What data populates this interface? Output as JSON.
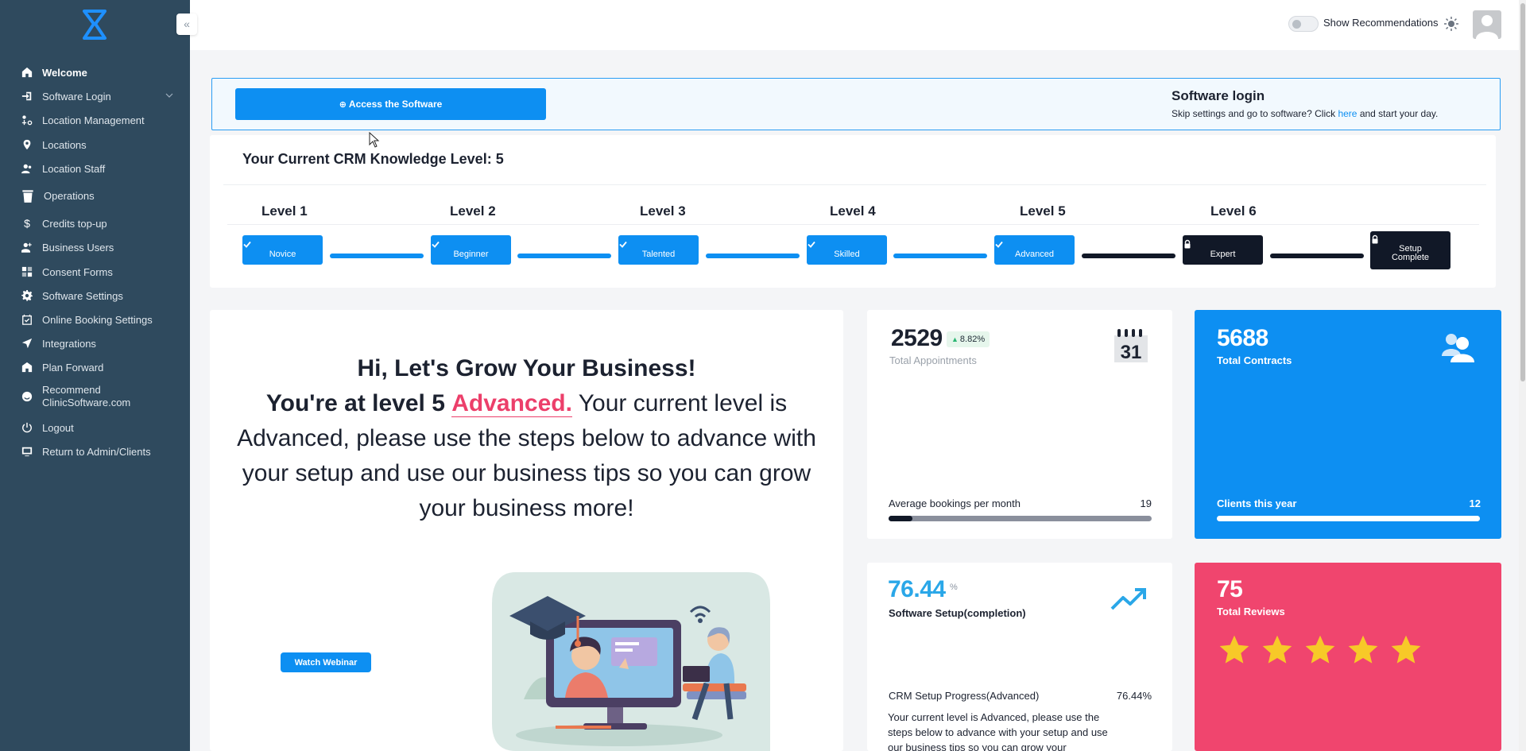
{
  "sidebar": {
    "items": [
      {
        "label": "Welcome",
        "icon": "home-icon",
        "active": true
      },
      {
        "label": "Software Login",
        "icon": "login-icon",
        "has_submenu": true
      },
      {
        "label": "Location Management",
        "icon": "location-management-icon"
      },
      {
        "label": "Locations",
        "icon": "map-pin-icon"
      },
      {
        "label": "Location Staff",
        "icon": "staff-icon"
      },
      {
        "label": "Operations",
        "icon": "trash-icon"
      },
      {
        "label": "Credits top-up",
        "icon": "dollar-icon"
      },
      {
        "label": "Business Users",
        "icon": "add-user-icon"
      },
      {
        "label": "Consent Forms",
        "icon": "grid-icon"
      },
      {
        "label": "Software Settings",
        "icon": "gear-icon"
      },
      {
        "label": "Online Booking Settings",
        "icon": "calendar-icon"
      },
      {
        "label": "Integrations",
        "icon": "send-icon"
      },
      {
        "label": "Plan Forward",
        "icon": "building-icon"
      },
      {
        "label": "Recommend ClinicSoftware.com",
        "icon": "smile-icon"
      },
      {
        "label": "Logout",
        "icon": "power-icon"
      },
      {
        "label": "Return to Admin/Clients",
        "icon": "monitor-icon"
      }
    ]
  },
  "topbar": {
    "toggle_label": "Show Recommendations",
    "toggle_on": false
  },
  "banner": {
    "button_label": "Access the Software",
    "title": "Software login",
    "subtitle_before": "Skip settings and go to software? Click",
    "subtitle_link": "here",
    "subtitle_after": "and start your day."
  },
  "knowledge": {
    "title": "Your Current CRM Knowledge Level: 5",
    "levels": [
      {
        "heading": "Level 1",
        "badge": "Novice",
        "state": "complete"
      },
      {
        "heading": "Level 2",
        "badge": "Beginner",
        "state": "complete"
      },
      {
        "heading": "Level 3",
        "badge": "Talented",
        "state": "complete"
      },
      {
        "heading": "Level 4",
        "badge": "Skilled",
        "state": "complete"
      },
      {
        "heading": "Level 5",
        "badge": "Advanced",
        "state": "complete"
      },
      {
        "heading": "Level 6",
        "badge": "Expert",
        "state": "locked"
      },
      {
        "heading": "",
        "badge": "Setup Complete",
        "state": "locked"
      }
    ]
  },
  "grow": {
    "line1": "Hi, Let's Grow Your Business!",
    "line2_prefix": "You're at level 5",
    "line2_level": "Advanced.",
    "line2_rest": "Your current level is Advanced, please use the steps below to advance with your setup and use our business tips so you can grow your business more!",
    "webinar_button": "Watch Webinar"
  },
  "appointments": {
    "value": "2529",
    "change": "8.82%",
    "label": "Total Appointments",
    "calendar_day": "31",
    "row_label": "Average bookings per month",
    "row_value": "19",
    "progress": 0.09
  },
  "contracts": {
    "value": "5688",
    "label": "Total Contracts",
    "row_label": "Clients this year",
    "row_value": "12",
    "progress": 1.0
  },
  "setup": {
    "value": "76.44",
    "unit": "%",
    "label": "Software Setup(completion)",
    "row_label": "CRM Setup Progress(Advanced)",
    "row_value": "76.44%",
    "description": "Your current level is Advanced, please use the steps below to advance with your setup and use our business tips so you can grow your"
  },
  "reviews": {
    "value": "75",
    "label": "Total Reviews",
    "stars": 5
  },
  "colors": {
    "sidebar_bg": "#2f4a5e",
    "accent_blue": "#0d8ff2",
    "accent_pink": "#f0456e",
    "locked_dark": "#111827",
    "star": "#f7c928"
  }
}
